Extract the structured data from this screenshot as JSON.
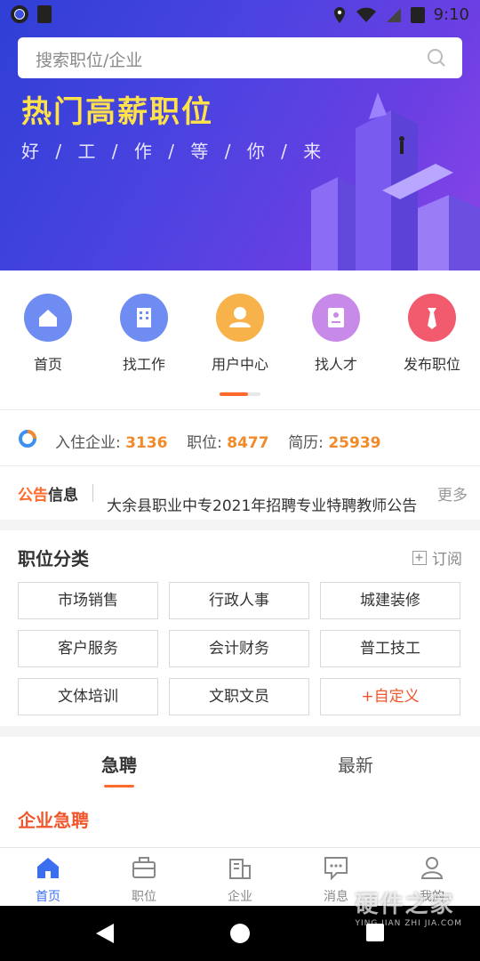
{
  "status_bar": {
    "time": "9:10"
  },
  "search": {
    "placeholder": "搜索职位/企业"
  },
  "banner": {
    "title": "热门高薪职位",
    "subtitle": "好 / 工 / 作 / 等 / 你 / 来"
  },
  "nav": [
    {
      "label": "首页",
      "icon": "home-icon",
      "color": "#6e8cf2"
    },
    {
      "label": "找工作",
      "icon": "building-icon",
      "color": "#6e8cf2"
    },
    {
      "label": "用户中心",
      "icon": "user-icon",
      "color": "#f7b24a"
    },
    {
      "label": "找人才",
      "icon": "resume-icon",
      "color": "#c88ae8"
    },
    {
      "label": "发布职位",
      "icon": "tie-icon",
      "color": "#f25a6e"
    }
  ],
  "stats": {
    "company_label": "入住企业:",
    "company_value": "3136",
    "job_label": "职位:",
    "job_value": "8477",
    "resume_label": "简历:",
    "resume_value": "25939"
  },
  "notice": {
    "logo_a": "公告",
    "logo_b": "信息",
    "text": "大余县职业中专2021年招聘专业特聘教师公告",
    "more": "更多"
  },
  "categories": {
    "title": "职位分类",
    "subscribe": "订阅",
    "items": [
      "市场销售",
      "行政人事",
      "城建装修",
      "客户服务",
      "会计财务",
      "普工技工",
      "文体培训",
      "文职文员",
      "+自定义"
    ]
  },
  "tabs": {
    "urgent": "急聘",
    "latest": "最新"
  },
  "urgent_section": {
    "title": "企业急聘"
  },
  "tabbar": [
    {
      "label": "首页",
      "icon": "home-icon",
      "active": true
    },
    {
      "label": "职位",
      "icon": "briefcase-icon",
      "active": false
    },
    {
      "label": "企业",
      "icon": "company-icon",
      "active": false
    },
    {
      "label": "消息",
      "icon": "message-icon",
      "active": false
    },
    {
      "label": "我的",
      "icon": "profile-icon",
      "active": false
    }
  ],
  "watermark": {
    "main": "硬件之家",
    "sub": "YING JIAN ZHI JIA.COM"
  },
  "colors": {
    "accent": "#ff6a2b",
    "active_tab": "#3b6ff0",
    "highlight": "#f08a2a"
  }
}
